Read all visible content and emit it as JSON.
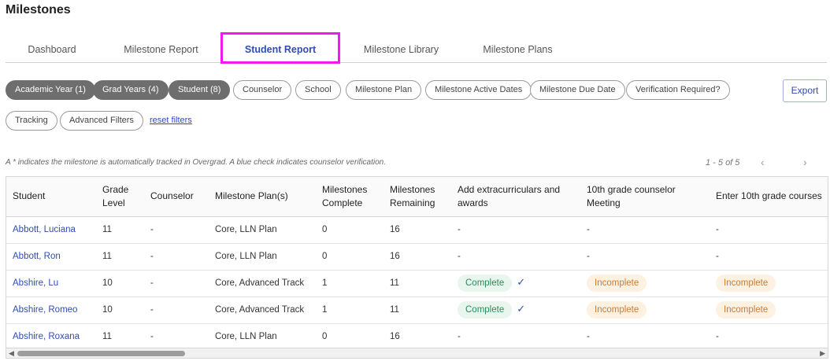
{
  "page_title": "Milestones",
  "tabs": [
    {
      "label": "Dashboard"
    },
    {
      "label": "Milestone Report"
    },
    {
      "label": "Student Report"
    },
    {
      "label": "Milestone Library"
    },
    {
      "label": "Milestone Plans"
    }
  ],
  "active_tab": "Student Report",
  "filters": [
    {
      "label": "Academic Year (1)",
      "active": true
    },
    {
      "label": "Grad Years (4)",
      "active": true
    },
    {
      "label": "Student (8)",
      "active": true
    },
    {
      "label": "Counselor",
      "active": false
    },
    {
      "label": "School",
      "active": false
    },
    {
      "label": "Milestone Plan",
      "active": false
    },
    {
      "label": "Milestone Active Dates",
      "active": false
    },
    {
      "label": "Milestone Due Date",
      "active": false
    },
    {
      "label": "Verification Required?",
      "active": false
    },
    {
      "label": "Tracking",
      "active": false
    },
    {
      "label": "Advanced Filters",
      "active": false
    }
  ],
  "reset_filters_label": "reset filters",
  "export_label": "Export",
  "info_text": "A * indicates the milestone is automatically tracked in Overgrad. A blue check indicates counselor verification.",
  "pagination": {
    "range": "1 - 5 of 5",
    "prev_icon": "chevron-left-icon",
    "next_icon": "chevron-right-icon"
  },
  "table": {
    "columns": [
      "Student",
      "Grade Level",
      "Counselor",
      "Milestone Plan(s)",
      "Milestones Complete",
      "Milestones Remaining",
      "Add extracurriculars and awards",
      "10th grade counselor Meeting",
      "Enter 10th grade courses"
    ],
    "rows": [
      {
        "student": "Abbott, Luciana",
        "grade": "11",
        "counselor": "-",
        "plans": "Core, LLN Plan",
        "complete": "0",
        "remaining": "16",
        "extracurriculars": {
          "text": "-",
          "status": "none",
          "verified": false
        },
        "meeting": {
          "text": "-",
          "status": "none"
        },
        "courses": {
          "text": "-",
          "status": "none"
        }
      },
      {
        "student": "Abbott, Ron",
        "grade": "11",
        "counselor": "-",
        "plans": "Core, LLN Plan",
        "complete": "0",
        "remaining": "16",
        "extracurriculars": {
          "text": "-",
          "status": "none",
          "verified": false
        },
        "meeting": {
          "text": "-",
          "status": "none"
        },
        "courses": {
          "text": "-",
          "status": "none"
        }
      },
      {
        "student": "Abshire, Lu",
        "grade": "10",
        "counselor": "-",
        "plans": "Core, Advanced Track",
        "complete": "1",
        "remaining": "11",
        "extracurriculars": {
          "text": "Complete",
          "status": "complete",
          "verified": true
        },
        "meeting": {
          "text": "Incomplete",
          "status": "incomplete"
        },
        "courses": {
          "text": "Incomplete",
          "status": "incomplete"
        }
      },
      {
        "student": "Abshire, Romeo",
        "grade": "10",
        "counselor": "-",
        "plans": "Core, Advanced Track",
        "complete": "1",
        "remaining": "11",
        "extracurriculars": {
          "text": "Complete",
          "status": "complete",
          "verified": true
        },
        "meeting": {
          "text": "Incomplete",
          "status": "incomplete"
        },
        "courses": {
          "text": "Incomplete",
          "status": "incomplete"
        }
      },
      {
        "student": "Abshire, Roxana",
        "grade": "11",
        "counselor": "-",
        "plans": "Core, LLN Plan",
        "complete": "0",
        "remaining": "16",
        "extracurriculars": {
          "text": "-",
          "status": "none",
          "verified": false
        },
        "meeting": {
          "text": "-",
          "status": "none"
        },
        "courses": {
          "text": "-",
          "status": "none"
        }
      }
    ]
  },
  "colors": {
    "accent": "#2f4db3",
    "highlight_border": "#f019ef",
    "complete_bg": "#e8f6ee",
    "complete_text": "#2d8a5b",
    "incomplete_bg": "#fdf1e2",
    "incomplete_text": "#d17a2d",
    "chip_filled": "#6e6e6e"
  }
}
